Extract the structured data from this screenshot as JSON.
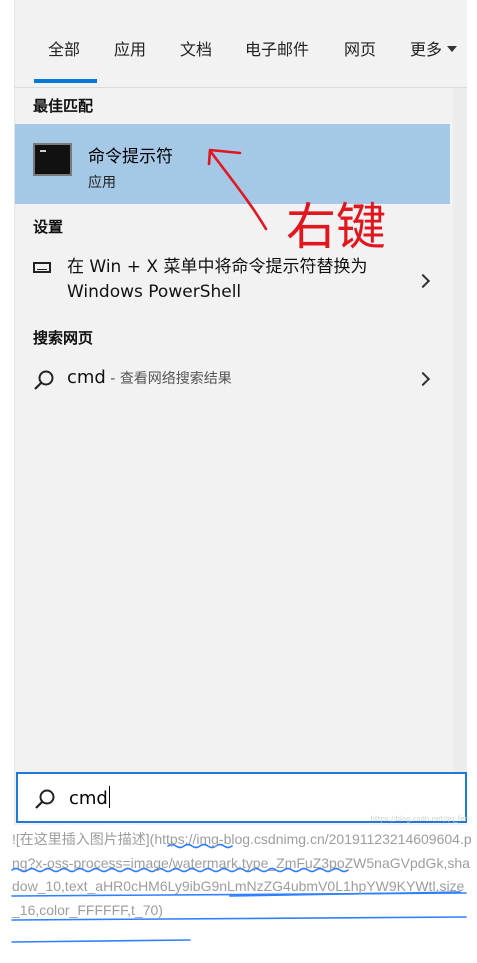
{
  "tabs": [
    {
      "label": "全部"
    },
    {
      "label": "应用"
    },
    {
      "label": "文档"
    },
    {
      "label": "电子邮件"
    },
    {
      "label": "网页"
    },
    {
      "label": "更多"
    }
  ],
  "sections": {
    "best_match": "最佳匹配",
    "settings": "设置",
    "web": "搜索网页"
  },
  "best_match_item": {
    "title": "命令提示符",
    "subtitle": "应用"
  },
  "settings_item": {
    "text": "在 Win + X 菜单中将命令提示符替换为 Windows PowerShell"
  },
  "web_item": {
    "query": "cmd",
    "separator": " - ",
    "action": "查看网络搜索结果"
  },
  "annotation": {
    "text": "右键",
    "color": "#e0171f"
  },
  "search_box": {
    "value": "cmd"
  },
  "watermark": "https://blog.csdn.net/qq_fen",
  "markdown_text": "![在这里插入图片描述](https://img-blog.csdnimg.cn/20191123214609604.png?x-oss-process=image/watermark,type_ZmFuZ3poZW5naGVpdGk,shadow_10,text_aHR0cHM6Ly9ibG9nLmNzZG4ubmV0L1hpYW9KYWtl,size_16,color_FFFFFF,t_70)",
  "colors": {
    "accent": "#0078d7",
    "selected_bg": "#a4c8e6",
    "panel_bg": "#f2f2f2",
    "underline": "#2f80ff"
  }
}
